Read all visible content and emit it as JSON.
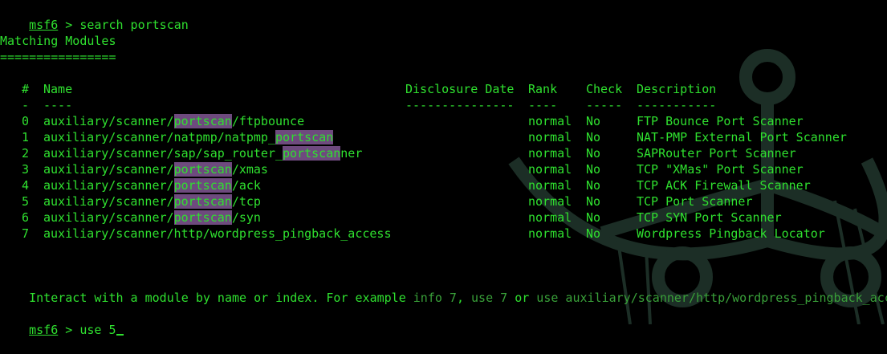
{
  "prompt1": {
    "name": "msf6",
    "sep": " > ",
    "command": "search portscan"
  },
  "heading": {
    "title": "Matching Modules",
    "underline": "================"
  },
  "table": {
    "headers": {
      "num": "#",
      "name": "Name",
      "date": "Disclosure Date",
      "rank": "Rank",
      "check": "Check",
      "desc": "Description"
    },
    "dashes": {
      "num": "-",
      "name": "----",
      "date": "---------------",
      "rank": "----",
      "check": "-----",
      "desc": "-----------"
    },
    "rows": [
      {
        "num": "0",
        "name_pre": "auxiliary/scanner/",
        "name_hl": "portscan",
        "name_post": "/ftpbounce",
        "date": "",
        "rank": "normal",
        "check": "No",
        "desc": "FTP Bounce Port Scanner"
      },
      {
        "num": "1",
        "name_pre": "auxiliary/scanner/natpmp/natpmp_",
        "name_hl": "portscan",
        "name_post": "",
        "date": "",
        "rank": "normal",
        "check": "No",
        "desc": "NAT-PMP External Port Scanner"
      },
      {
        "num": "2",
        "name_pre": "auxiliary/scanner/sap/sap_router_",
        "name_hl": "portscan",
        "name_post": "ner",
        "date": "",
        "rank": "normal",
        "check": "No",
        "desc": "SAPRouter Port Scanner"
      },
      {
        "num": "3",
        "name_pre": "auxiliary/scanner/",
        "name_hl": "portscan",
        "name_post": "/xmas",
        "date": "",
        "rank": "normal",
        "check": "No",
        "desc": "TCP \"XMas\" Port Scanner"
      },
      {
        "num": "4",
        "name_pre": "auxiliary/scanner/",
        "name_hl": "portscan",
        "name_post": "/ack",
        "date": "",
        "rank": "normal",
        "check": "No",
        "desc": "TCP ACK Firewall Scanner"
      },
      {
        "num": "5",
        "name_pre": "auxiliary/scanner/",
        "name_hl": "portscan",
        "name_post": "/tcp",
        "date": "",
        "rank": "normal",
        "check": "No",
        "desc": "TCP Port Scanner"
      },
      {
        "num": "6",
        "name_pre": "auxiliary/scanner/",
        "name_hl": "portscan",
        "name_post": "/syn",
        "date": "",
        "rank": "normal",
        "check": "No",
        "desc": "TCP SYN Port Scanner"
      },
      {
        "num": "7",
        "name_pre": "auxiliary/scanner/http/wordpress_pingback_access",
        "name_hl": "",
        "name_post": "",
        "date": "",
        "rank": "normal",
        "check": "No",
        "desc": "Wordpress Pingback Locator"
      }
    ]
  },
  "interact": {
    "text1": "Interact with a module by name or index. For example ",
    "ex1": "info 7",
    "sep1": ", ",
    "ex2": "use 7",
    "text2": " or ",
    "ex3": "use auxiliary/scanner/http/wordpress_pingback_access"
  },
  "prompt2": {
    "name": "msf6",
    "sep": " > ",
    "command": "use 5"
  },
  "colors": {
    "text": "#2fe02f",
    "highlight": "#6e4a7e",
    "dim": "#39a039",
    "background": "#000000",
    "logo": "#1c2e26"
  }
}
